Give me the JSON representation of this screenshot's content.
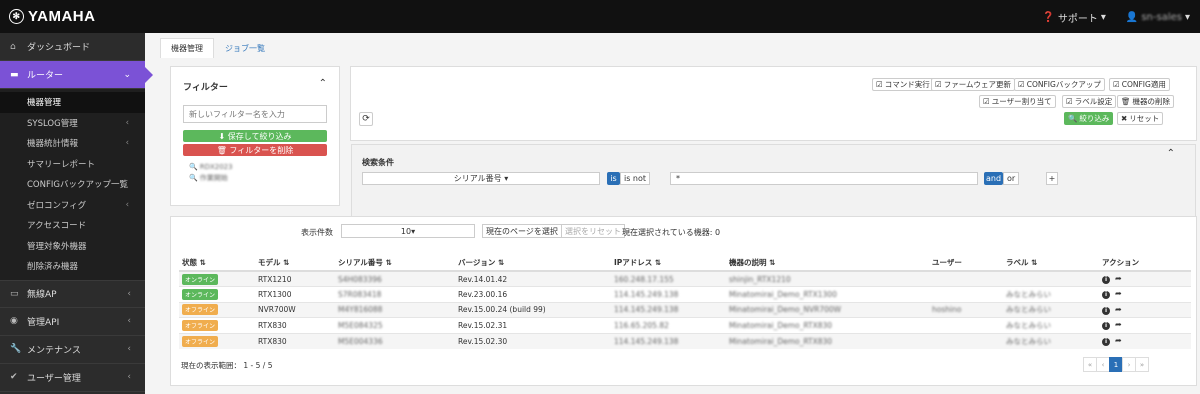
{
  "header": {
    "logo_text": "YAMAHA",
    "support": "サポート",
    "user": "sn-sales"
  },
  "sidebar": {
    "dashboard": "ダッシュボード",
    "router": "ルーター",
    "router_items": [
      {
        "label": "機器管理",
        "chev": ""
      },
      {
        "label": "SYSLOG管理",
        "chev": "‹"
      },
      {
        "label": "機器統計情報",
        "chev": "‹"
      },
      {
        "label": "サマリーレポート",
        "chev": ""
      },
      {
        "label": "CONFIGバックアップ一覧",
        "chev": ""
      },
      {
        "label": "ゼロコンフィグ",
        "chev": "‹"
      },
      {
        "label": "アクセスコード",
        "chev": ""
      },
      {
        "label": "管理対象外機器",
        "chev": ""
      },
      {
        "label": "削除済み機器",
        "chev": ""
      }
    ],
    "wireless_ap": "無線AP",
    "mgmt_api": "管理API",
    "maintenance": "メンテナンス",
    "user_mgmt": "ユーザー管理"
  },
  "tabs": [
    "機器管理",
    "ジョブ一覧"
  ],
  "filter": {
    "title": "フィルター",
    "placeholder": "新しいフィルター名を入力",
    "save": "保存して絞り込み",
    "delete": "フィルターを削除",
    "saved": [
      "RDX2023",
      "作業開始"
    ]
  },
  "actions": {
    "command": "コマンド実行",
    "firmware": "ファームウェア更新",
    "backup": "CONFIGバックアップ",
    "apply": "CONFIG適用",
    "assign_user": "ユーザー割り当て",
    "label": "ラベル設定",
    "delete": "機器の削除",
    "filter": "絞り込み",
    "reset": "リセット"
  },
  "search": {
    "title": "検索条件",
    "field": "シリアル番号",
    "is": "is",
    "is_not": "is not",
    "value": "*",
    "and": "and",
    "or": "or",
    "add": "+"
  },
  "table_controls": {
    "count_label": "表示件数",
    "count_value": "10",
    "select_page": "現在のページを選択",
    "reset_selection": "選択をリセット",
    "selected": "現在選択されている機器: 0"
  },
  "table": {
    "headers": [
      "状態",
      "モデル",
      "シリアル番号",
      "バージョン",
      "IPアドレス",
      "機器の説明",
      "ユーザー",
      "ラベル",
      "アクション"
    ],
    "rows": [
      {
        "status": "オンライン",
        "status_type": "online",
        "model": "RTX1210",
        "serial": "S4H083396",
        "version": "Rev.14.01.42",
        "ip": "160.248.17.155",
        "desc": "shinjin_RTX1210",
        "user": "",
        "label": ""
      },
      {
        "status": "オンライン",
        "status_type": "online",
        "model": "RTX1300",
        "serial": "S7R083418",
        "version": "Rev.23.00.16",
        "ip": "114.145.249.138",
        "desc": "Minatomirai_Demo_RTX1300",
        "user": "",
        "label": "みなとみらい"
      },
      {
        "status": "オフライン",
        "status_type": "offline",
        "model": "NVR700W",
        "serial": "M4Y816088",
        "version": "Rev.15.00.24 (build 99)",
        "ip": "114.145.249.138",
        "desc": "Minatomirai_Demo_NVR700W",
        "user": "hoshino",
        "label": "みなとみらい"
      },
      {
        "status": "オフライン",
        "status_type": "offline",
        "model": "RTX830",
        "serial": "M5E084325",
        "version": "Rev.15.02.31",
        "ip": "116.65.205.82",
        "desc": "Minatomirai_Demo_RTX830",
        "user": "",
        "label": "みなとみらい"
      },
      {
        "status": "オフライン",
        "status_type": "offline",
        "model": "RTX830",
        "serial": "M5E004336",
        "version": "Rev.15.02.30",
        "ip": "114.145.249.138",
        "desc": "Minatomirai_Demo_RTX830",
        "user": "",
        "label": "みなとみらい"
      }
    ]
  },
  "footer": {
    "range": "現在の表示範囲： 1 - 5 / 5",
    "pages": [
      "«",
      "‹",
      "1",
      "›",
      "»"
    ]
  },
  "colors": {
    "accent": "#7b52d6",
    "success": "#5cb85c",
    "danger": "#d9534f",
    "warning": "#f0ad4e",
    "primary": "#2a6fb6"
  }
}
